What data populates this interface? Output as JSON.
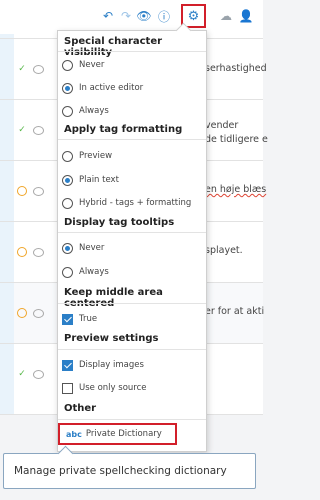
{
  "toolbar": {
    "icons": [
      "undo-icon",
      "redo-icon",
      "preview-eye-icon",
      "info-icon",
      "settings-gears-icon",
      "cloud-icon",
      "user-icon"
    ]
  },
  "rows": [
    {
      "status": "ok",
      "text": "serhastighed"
    },
    {
      "status": "ok",
      "text": "vender",
      "text2": "de tidligere e"
    },
    {
      "status": "pending",
      "text": "en høje blæs"
    },
    {
      "status": "pending",
      "text": "splayet."
    },
    {
      "status": "pending",
      "text": "er for at akti"
    },
    {
      "status": "ok",
      "text": ""
    }
  ],
  "panel": {
    "special_chars": {
      "title": "Special character visibility",
      "options": [
        {
          "label": "Never",
          "selected": false
        },
        {
          "label": "In active editor",
          "selected": true
        },
        {
          "label": "Always",
          "selected": false
        }
      ]
    },
    "tag_formatting": {
      "title": "Apply tag formatting",
      "options": [
        {
          "label": "Preview",
          "selected": false
        },
        {
          "label": "Plain text",
          "selected": true
        },
        {
          "label": "Hybrid - tags + formatting",
          "selected": false
        }
      ]
    },
    "tag_tooltips": {
      "title": "Display tag tooltips",
      "options": [
        {
          "label": "Never",
          "selected": true
        },
        {
          "label": "Always",
          "selected": false
        }
      ]
    },
    "middle_area": {
      "title": "Keep middle area centered",
      "options": [
        {
          "label": "True",
          "checked": true
        }
      ]
    },
    "preview": {
      "title": "Preview settings",
      "options": [
        {
          "label": "Display images",
          "checked": true
        },
        {
          "label": "Use only source",
          "checked": false
        }
      ]
    },
    "other": {
      "title": "Other",
      "dictionary_icon": "abc",
      "dictionary_label": "Private Dictionary"
    }
  },
  "tooltip": {
    "text": "Manage private spellchecking dictionary"
  },
  "colors": {
    "accent": "#2b7fc7",
    "highlight_border": "#d21f2a",
    "ok": "#58b84a",
    "pending": "#f0a62a"
  }
}
